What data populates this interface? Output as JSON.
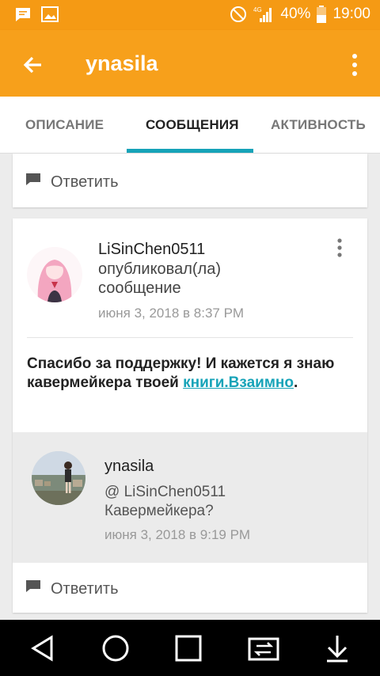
{
  "status_bar": {
    "battery": "40%",
    "time": "19:00",
    "network": "4G"
  },
  "app_bar": {
    "title": "ynasila"
  },
  "tabs": [
    {
      "label": "ОПИСАНИЕ"
    },
    {
      "label": "СООБЩЕНИЯ"
    },
    {
      "label": "АКТИВНОСТЬ"
    }
  ],
  "card1": {
    "reply_label": "Ответить"
  },
  "post": {
    "author": "LiSinChen0511",
    "action_line1": "опубликовал(ла)",
    "action_line2": "сообщение",
    "date": "июня 3, 2018 в 8:37 PM",
    "body_text": "Спасибо за поддержку! И кажется я знаю кавермейкера твоей ",
    "body_link": "книги.Взаимно",
    "body_end": ".",
    "reply_label": "Ответить"
  },
  "comment": {
    "author": "ynasila",
    "mention": "@ LiSinChen0511",
    "text": "Кавермейкера?",
    "date": "июня 3, 2018 в 9:19 PM"
  },
  "colors": {
    "accent": "#f7a01b",
    "link": "#16a3b8"
  }
}
